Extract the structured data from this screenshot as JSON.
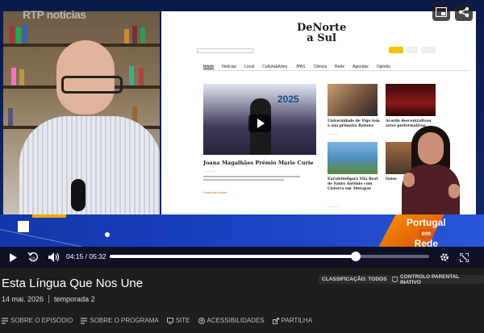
{
  "player": {
    "watermark": "RTP notícias",
    "website": {
      "logo_line1": "DeNorte",
      "logo_line2": "a Sul",
      "nav": [
        "Início",
        "Notícias",
        "Local",
        "Cultura&Artes",
        "JPAS",
        "Ciência",
        "Rede",
        "Agendas",
        "Opinião"
      ],
      "hero_year": "2025",
      "hero_title": "Joana Magalhães Prémio Marie Curie",
      "hero_more": "Continuar leitura",
      "cards": [
        {
          "title": "Universidade de Vigo tem a sua primeira Reitora"
        },
        {
          "title": "Acordo descentralizou artes performativas"
        },
        {
          "title": "Euroleiteligará Vila Real de Santo Antônio com Cisterra em 30etapas"
        },
        {
          "title": "Oaise"
        }
      ]
    },
    "banner": {
      "line1": "Portugal",
      "em": "em",
      "line2": "Rede"
    },
    "controls": {
      "time_current": "04:15",
      "time_sep": "/",
      "time_total": "05:32",
      "progress": 0.77
    }
  },
  "episode": {
    "title": "Esta Língua Que Nos Une",
    "date": "14 mai. 2026",
    "season": "temporada 2",
    "classification": "CLASSIFICAÇÃO: TODOS",
    "parental": "CONTROLO PARENTAL INATIVO"
  },
  "tabs": [
    {
      "label": "SOBRE O EPISÓDIO",
      "icon": "list-icon"
    },
    {
      "label": "SOBRE O PROGRAMA",
      "icon": "list-icon"
    },
    {
      "label": "SITE",
      "icon": "monitor-icon"
    },
    {
      "label": "ACESSIBILIDADES",
      "icon": "accessibility-icon"
    },
    {
      "label": "PARTILHA",
      "icon": "share-icon"
    }
  ]
}
